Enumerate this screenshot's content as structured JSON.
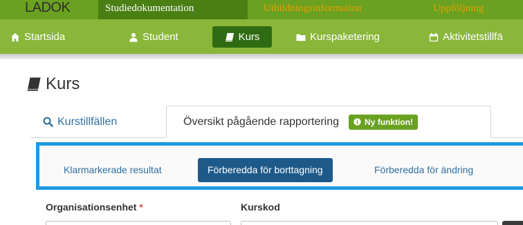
{
  "app": {
    "logo_text": "LADOK",
    "top_tabs": [
      {
        "label": "Studiedokumentation",
        "active": true
      },
      {
        "label": "Utbildningsinformation",
        "active": false
      },
      {
        "label": "Uppföljning",
        "active": false
      }
    ]
  },
  "nav": {
    "items": [
      {
        "label": "Startsida",
        "icon": "home-icon"
      },
      {
        "label": "Student",
        "icon": "user-icon"
      },
      {
        "label": "Kurs",
        "icon": "book-icon",
        "active": true
      },
      {
        "label": "Kurspaketering",
        "icon": "folder-icon"
      },
      {
        "label": "Aktivitetstillfä",
        "icon": "calendar-icon"
      }
    ]
  },
  "page": {
    "title": "Kurs",
    "title_icon": "book-icon"
  },
  "tabs": [
    {
      "label": "Kurstillfällen",
      "icon": "search-icon",
      "active": false
    },
    {
      "label": "Översikt pågående rapportering",
      "active": true,
      "badge": "Ny funktion!"
    }
  ],
  "subtabs": [
    {
      "label": "Klarmarkerade resultat",
      "active": false
    },
    {
      "label": "Förberedda för borttagning",
      "active": true
    },
    {
      "label": "Förberedda för ändring",
      "active": false
    }
  ],
  "form": {
    "org_label": "Organisationsenhet",
    "org_required_mark": "*",
    "course_code_label": "Kurskod"
  },
  "colors": {
    "topbar": "#6aa121",
    "navbar": "#8ab63a",
    "nav_active": "#2f6b13",
    "highlight_border": "#1e9ae0",
    "subtab_active": "#1d5a8a",
    "link": "#2f6f9f",
    "badge": "#6aa121",
    "required": "#d9534f"
  }
}
